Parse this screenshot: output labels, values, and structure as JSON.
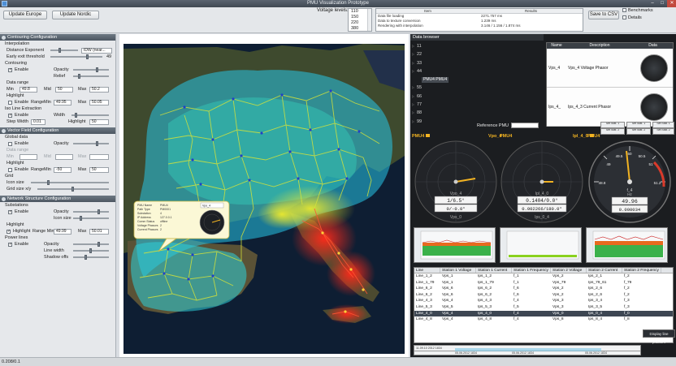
{
  "window": {
    "title": "PMU Visualization Prototype",
    "min": "–",
    "max": "□",
    "close": "✕"
  },
  "toolbar": {
    "update_europe": "Update Europe",
    "update_nordic": "Update Nordic",
    "voltage_label": "Voltage levels:",
    "voltage_levels": [
      "110",
      "150",
      "220",
      "380"
    ],
    "results": {
      "headers": [
        "Item",
        "Results"
      ],
      "rows": [
        [
          "Data file loading",
          "2271.757 ms"
        ],
        [
          "Data to texture conversion",
          "1.239 ms"
        ],
        [
          "Rendering with interpolation",
          "3.146 / 1.156 / 1.874 ms"
        ]
      ]
    },
    "save_csv": "Save to CSV",
    "benchmarks": "Benchmarks",
    "details": "Details"
  },
  "contouring": {
    "header": "Contouring Configuration",
    "interpolation": "Interpolation",
    "distance_exponent": "Distance Exponent",
    "method": "IDW (near...",
    "early_exit": "Early exit threshold",
    "early_exit_value": "49",
    "contouring": "Contouring",
    "enable": "Enable",
    "opacity": "Opacity",
    "relief": "Relief",
    "data_range": "Data range",
    "min": "Min",
    "min_val": "49.8",
    "mid": "Mid",
    "mid_val": "50",
    "max": "Max",
    "max_val": "50.2",
    "highlight": "Highlight",
    "range": "Range",
    "range_min_val": "49.95",
    "range_max_val": "50.05",
    "iso": "Iso Line Extraction",
    "width": "Width",
    "step_width": "Step Width",
    "step_width_val": "0.01",
    "highlight_label": "Highlight",
    "highlight_val": "50"
  },
  "vector": {
    "header": "Vector Field Configuration",
    "global_data": "Global data",
    "enable": "Enable",
    "opacity": "Opacity",
    "data_range": "Data range",
    "min": "Min",
    "mid": "Mid",
    "max": "Max",
    "highlight": "Highlight",
    "range": "Range",
    "range_min_label": "Min",
    "range_min_val": "-50",
    "range_max_label": "Max",
    "range_max_val": "50",
    "grid": "Grid",
    "icon_size": "Icon size",
    "grid_size": "Grid size x/y"
  },
  "network": {
    "header": "Network Structure Configuration",
    "substations": "Substations",
    "enable": "Enable",
    "opacity": "Opacity",
    "icon_size": "Icon size",
    "highlight": "Highlight",
    "range_min_label": "Range Min",
    "range_min_val": "49.99",
    "max": "Max",
    "max_val": "50.01",
    "power_lines": "Power lines",
    "line_width": "Line width",
    "shadow_offs": "Shadow offs"
  },
  "map": {
    "popup": {
      "labels": [
        "PMU Name",
        "Path Type",
        "Substation",
        "IP Address",
        "Comm Status",
        "Voltage Phasors",
        "Current Phasors"
      ],
      "values": [
        "PMU4",
        "PM0001",
        "4",
        "127.0.0.1",
        "offline",
        "2",
        "2"
      ],
      "select": "Vpo_4"
    }
  },
  "databrowser": {
    "header": "Data browser",
    "items": [
      "11",
      "22",
      "33",
      "44",
      "PMU4 PMU4",
      "55",
      "66",
      "77",
      "88",
      "99"
    ],
    "table_headers": [
      "Name",
      "Description",
      "Data"
    ],
    "rows": [
      {
        "name": "Vps_4",
        "desc": "Vps_4 Voltage Phasor"
      },
      {
        "name": "Ips_4_",
        "desc": "Ips_4_3 Current Phasor"
      }
    ]
  },
  "reference": {
    "label": "Reference PMU"
  },
  "gauges": [
    {
      "title": "PMU4",
      "readout": "1/6.5°",
      "sub": "0/-0.0°",
      "var": "Vpo_4",
      "var2": "Vps_0"
    },
    {
      "title": "PMU4",
      "readout": "0.1404/0.0°",
      "sub": "0.002266/180.0°",
      "var": "Ipl_4_0",
      "var2": "Ips_0_4"
    },
    {
      "title": "f_4",
      "readout": "49.96",
      "sub": "0.000034",
      "var": "f_4",
      "unit": "Hz"
    }
  ],
  "dial_labels": {
    "gauge3": [
      "49",
      "49.5",
      "50",
      "50.5",
      "51",
      "48.8",
      "51.2"
    ]
  },
  "grid": {
    "headers": [
      "Line",
      "Station 1 Voltage",
      "Station 1 Current",
      "Station 1 Frequency",
      "Station 2 Voltage",
      "Station 2 Current",
      "Station 2 Frequency"
    ],
    "rows": [
      [
        "Line_1_2",
        "Vps_1",
        "Ips_1_2",
        "f_1",
        "Vps_2",
        "Ips_2_1",
        "f_2"
      ],
      [
        "Line_1_79",
        "Vps_1",
        "Ips_1_79",
        "f_1",
        "Vps_79",
        "Ips_79_61",
        "f_79"
      ],
      [
        "Line_6_2",
        "Vps_6",
        "Ips_6_2",
        "f_6",
        "Vps_2",
        "Ips_2_6",
        "f_2"
      ],
      [
        "Line_6_2",
        "Vps_6",
        "Ips_6_2",
        "f_6",
        "Vps_2",
        "Ips_2_6",
        "f_2"
      ],
      [
        "Line_4_3",
        "Vps_4",
        "Ips_4_3",
        "f_4",
        "Vps_3",
        "Ips_3_4",
        "f_3"
      ],
      [
        "Line_5_3",
        "Vps_5",
        "Ips_5_3",
        "f_5",
        "Vps_3",
        "Ips_3_5",
        "f_3"
      ],
      [
        "Line_4_0",
        "Vps_4",
        "Ips_4_0",
        "f_4",
        "Vps_0",
        "Ips_0_4",
        "f_0"
      ],
      [
        "Line_4_8",
        "Vps_4",
        "Ips_4_8",
        "f_4",
        "Vps_8",
        "Ips_8_4",
        "f_8"
      ]
    ],
    "highlight_row": 6
  },
  "set_buttons": [
    "Set Stat. 1",
    "Set Stat. 1",
    "Set Stat. 1",
    "Set Stat. 2",
    "Set Stat. 2",
    "Set Stat. 2"
  ],
  "timeline": {
    "dates": [
      "05.06.2012 1834",
      "05.06.2012 1834",
      "05.06.2012 1834"
    ],
    "start": "11.09.10 2012 1834"
  },
  "display_line_phasors": "Display line phasors",
  "status": "0.208/0.1"
}
